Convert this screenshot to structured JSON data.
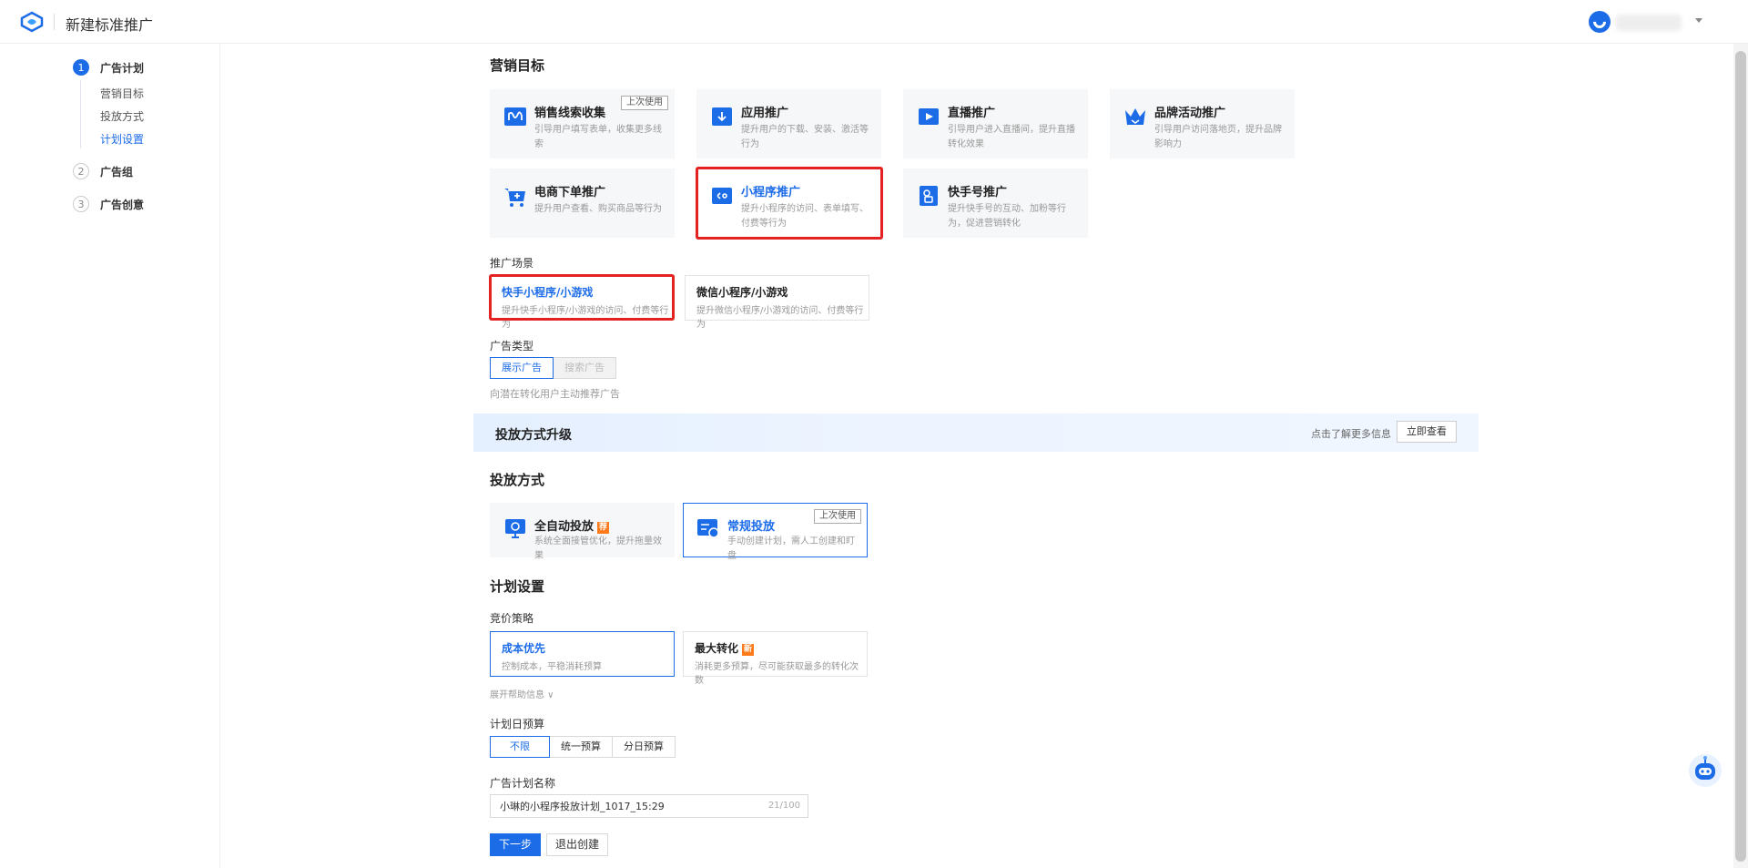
{
  "header": {
    "title": "新建标准推广"
  },
  "colors": {
    "primary": "#1c6ce8",
    "highlight": "#e52222",
    "hot": "#ff7a1a"
  },
  "sidebar": {
    "steps": [
      {
        "num": "1",
        "label": "广告计划"
      },
      {
        "num": "2",
        "label": "广告组"
      },
      {
        "num": "3",
        "label": "广告创意"
      }
    ],
    "substeps": [
      "营销目标",
      "投放方式",
      "计划设置"
    ]
  },
  "marketing": {
    "title": "营销目标",
    "cards": [
      {
        "title": "销售线索收集",
        "desc": "引导用户填写表单，收集更多线索",
        "badge": "上次使用",
        "icon": "wave-icon"
      },
      {
        "title": "应用推广",
        "desc": "提升用户的下载、安装、激活等行为",
        "icon": "download-icon"
      },
      {
        "title": "直播推广",
        "desc": "引导用户进入直播间，提升直播转化效果",
        "icon": "live-play-icon"
      },
      {
        "title": "品牌活动推广",
        "desc": "引导用户访问落地页，提升品牌影响力",
        "icon": "crown-icon"
      },
      {
        "title": "电商下单推广",
        "desc": "提升用户查看、购买商品等行为",
        "icon": "cart-icon"
      },
      {
        "title": "小程序推广",
        "desc": "提升小程序的访问、表单填写、付费等行为",
        "icon": "mini-program-icon"
      },
      {
        "title": "快手号推广",
        "desc": "提升快手号的互动、加粉等行为，促进营销转化",
        "icon": "kuaishou-account-icon"
      }
    ]
  },
  "scene": {
    "label": "推广场景",
    "options": [
      {
        "title": "快手小程序/小游戏",
        "desc": "提升快手小程序/小游戏的访问、付费等行为"
      },
      {
        "title": "微信小程序/小游戏",
        "desc": "提升微信小程序/小游戏的访问、付费等行为"
      }
    ]
  },
  "ad_type": {
    "label": "广告类型",
    "options": [
      "展示广告",
      "搜索广告"
    ],
    "hint": "向潜在转化用户主动推荐广告"
  },
  "banner": {
    "title": "投放方式升级",
    "hint": "点击了解更多信息",
    "button": "立即查看"
  },
  "delivery": {
    "title": "投放方式",
    "options": [
      {
        "title": "全自动投放",
        "desc": "系统全面接管优化，提升拖量效果",
        "tag": "荐"
      },
      {
        "title": "常规投放",
        "desc": "手动创建计划，需人工创建和盯盘",
        "badge": "上次使用"
      }
    ]
  },
  "plan": {
    "title": "计划设置",
    "bid_label": "竞价策略",
    "bid_options": [
      {
        "title": "成本优先",
        "desc": "控制成本，平稳消耗预算"
      },
      {
        "title": "最大转化",
        "desc": "消耗更多预算，尽可能获取最多的转化次数",
        "tag": "新"
      }
    ],
    "bid_hint": "展开帮助信息 ∨",
    "budget_label": "计划日预算",
    "budget_options": [
      "不限",
      "统一预算",
      "分日预算"
    ],
    "name_label": "广告计划名称",
    "name_value": "小琳的小程序投放计划_1017_15:29",
    "name_count": "21/100"
  },
  "actions": {
    "next": "下一步",
    "exit": "退出创建"
  }
}
